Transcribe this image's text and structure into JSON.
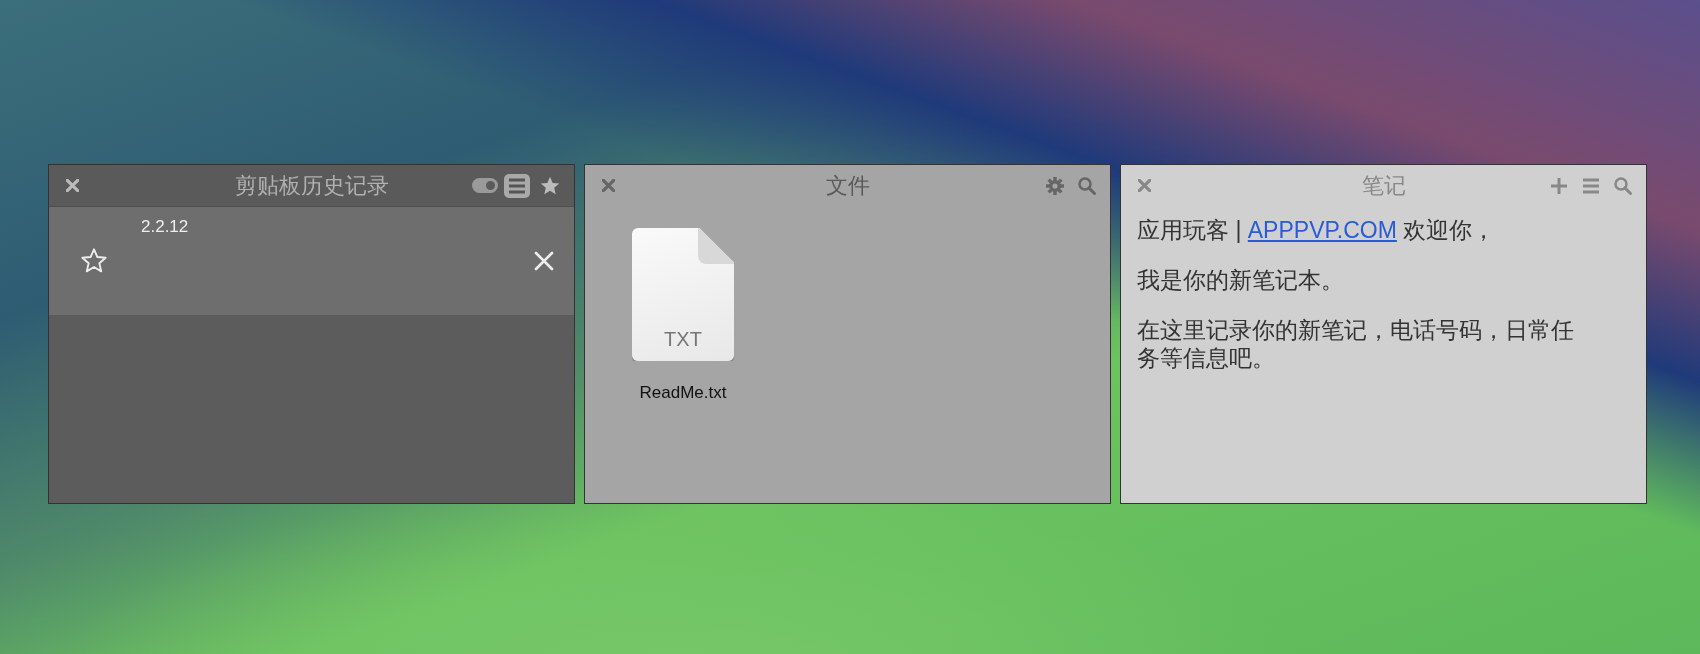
{
  "windows": [
    {
      "kind": "clipboard",
      "title": "剪贴板历史记录",
      "toggle": {
        "on": true
      },
      "list_button": {
        "selected": true
      },
      "items": [
        {
          "text": "2.2.12",
          "starred": false
        }
      ]
    },
    {
      "kind": "files",
      "title": "文件",
      "files": [
        {
          "name": "ReadMe.txt",
          "type_label": "TXT"
        }
      ]
    },
    {
      "kind": "notes",
      "title": "笔记",
      "paragraphs": [
        [
          {
            "text": "应用玩客 | "
          },
          {
            "text": "APPPVP.COM",
            "link": true
          },
          {
            "text": " 欢迎你，"
          }
        ],
        [
          {
            "text": "我是你的新笔记本。"
          }
        ],
        [
          {
            "text": "在这里记录你的新笔记，电话号码，日常任务等信息吧。"
          }
        ]
      ]
    }
  ]
}
